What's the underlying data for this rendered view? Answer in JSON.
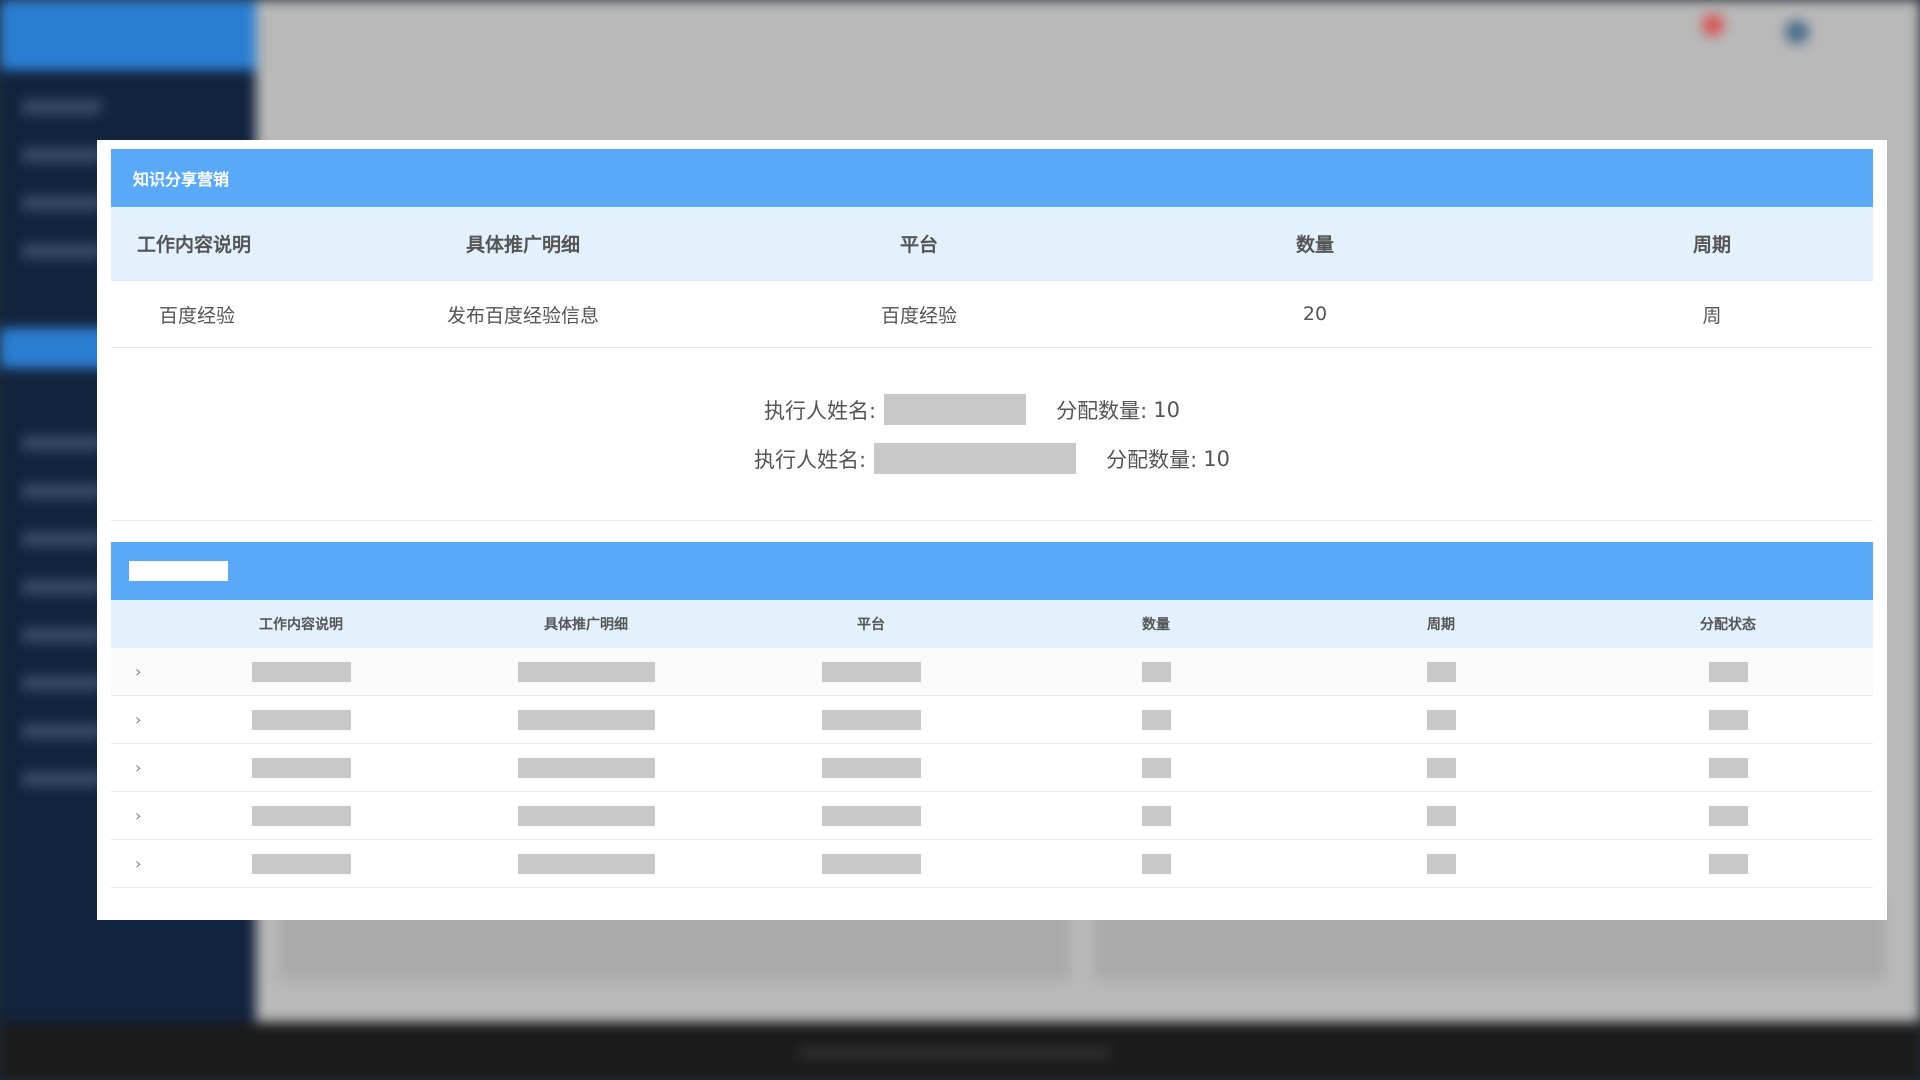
{
  "card_knowledge": {
    "title": "知识分享营销",
    "headers": [
      "工作内容说明",
      "具体推广明细",
      "平台",
      "数量",
      "周期"
    ],
    "row": [
      "百度经验",
      "发布百度经验信息",
      "百度经验",
      "20",
      "周"
    ],
    "assignments": [
      {
        "name_label": "执行人姓名:",
        "qty_label": "分配数量:",
        "qty": "10"
      },
      {
        "name_label": "执行人姓名:",
        "qty_label": "分配数量:",
        "qty": "10"
      }
    ]
  },
  "card_list": {
    "headers": [
      "工作内容说明",
      "具体推广明细",
      "平台",
      "数量",
      "周期",
      "分配状态"
    ],
    "expander_glyph": "›"
  },
  "colors": {
    "header_blue": "#5aa9f7",
    "table_head_bg": "#e3f1fd",
    "placeholder_gray": "#c8c8c8"
  }
}
